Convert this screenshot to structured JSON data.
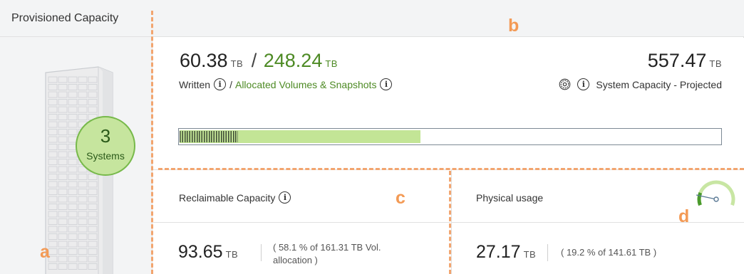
{
  "header": {
    "title": "Provisioned Capacity"
  },
  "left_panel": {
    "systems_count": "3",
    "systems_label": "Systems"
  },
  "written": {
    "value": "60.38",
    "unit": "TB",
    "label": "Written"
  },
  "allocated": {
    "value": "248.24",
    "unit": "TB",
    "label": "Allocated Volumes & Snapshots"
  },
  "separator": "/",
  "system_capacity": {
    "value": "557.47",
    "unit": "TB",
    "label": "System Capacity - Projected"
  },
  "bar": {
    "written_fraction": 0.108,
    "allocated_fraction": 0.445
  },
  "reclaimable": {
    "title": "Reclaimable Capacity",
    "value": "93.65",
    "unit": "TB",
    "detail_line1": "( 58.1 % of 161.31 TB Vol.",
    "detail_line2": "allocation )"
  },
  "physical": {
    "title": "Physical usage",
    "value": "27.17",
    "unit": "TB",
    "detail": "( 19.2 % of 141.61 TB )",
    "gauge_fraction": 0.192
  },
  "annotations": {
    "a": "a",
    "b": "b",
    "c": "c",
    "d": "d"
  },
  "colors": {
    "accent_green": "#4d8a24",
    "light_green": "#c3e596",
    "annotation_orange": "#f39a55"
  }
}
